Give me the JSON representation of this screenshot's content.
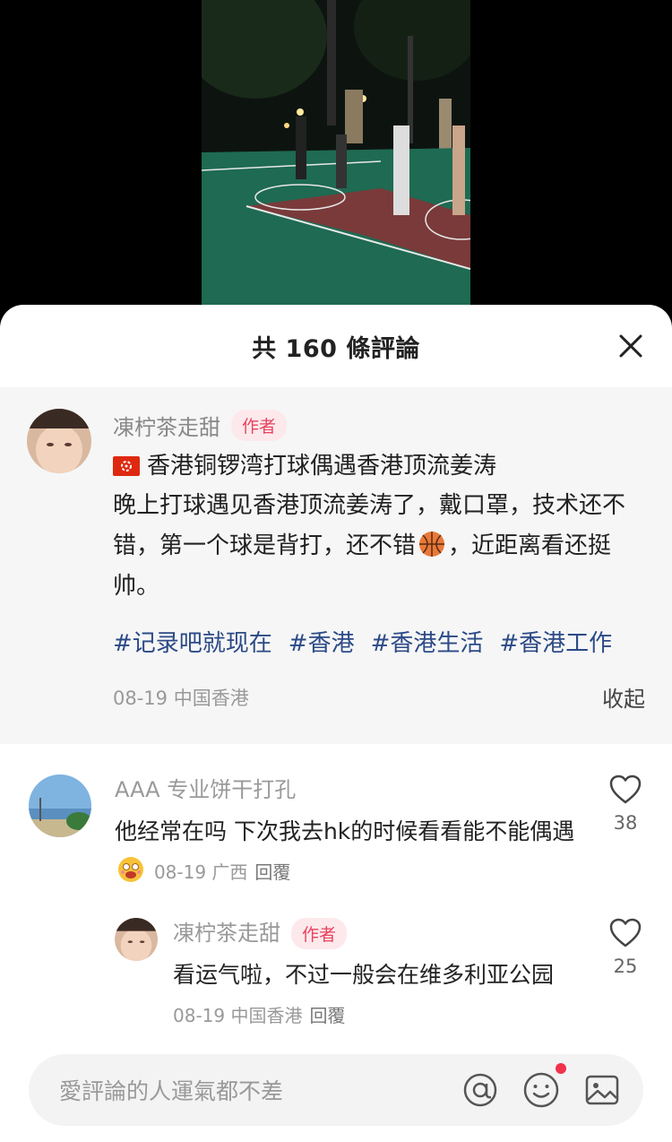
{
  "sheet": {
    "title": "共 160 條評論"
  },
  "post": {
    "author": "凍柠茶走甜",
    "author_badge": "作者",
    "title": "香港铜锣湾打球偶遇香港顶流姜涛",
    "text_before_emoji": "晚上打球遇见香港顶流姜涛了，戴口罩，技术还不错，第一个球是背打，还不错",
    "text_after_emoji": "，近距离看还挺帅。",
    "tags": [
      "#记录吧就现在",
      "#香港",
      "#香港生活",
      "#香港工作"
    ],
    "date_location": "08-19 中国香港",
    "collapse_label": "收起"
  },
  "comments": [
    {
      "name": "AAA 专业饼干打孔",
      "text": "他经常在吗 下次我去hk的时候看看能不能偶遇",
      "meta": "08-19 广西",
      "reply_label": "回覆",
      "likes": "38"
    },
    {
      "name": "凍柠茶走甜",
      "badge": "作者",
      "text": "看运气啦，不过一般会在维多利亚公园",
      "meta": "08-19 中国香港",
      "reply_label": "回覆",
      "likes": "25"
    }
  ],
  "input": {
    "placeholder": "愛評論的人運氣都不差"
  },
  "icons": {
    "close": "close-icon",
    "like": "heart-outline-icon",
    "mention": "at-icon",
    "emoji": "smiley-icon",
    "image": "image-icon"
  },
  "colors": {
    "accent_red": "#e8435f",
    "tag_blue": "#2b4a86",
    "notification_dot": "#f0334b"
  }
}
